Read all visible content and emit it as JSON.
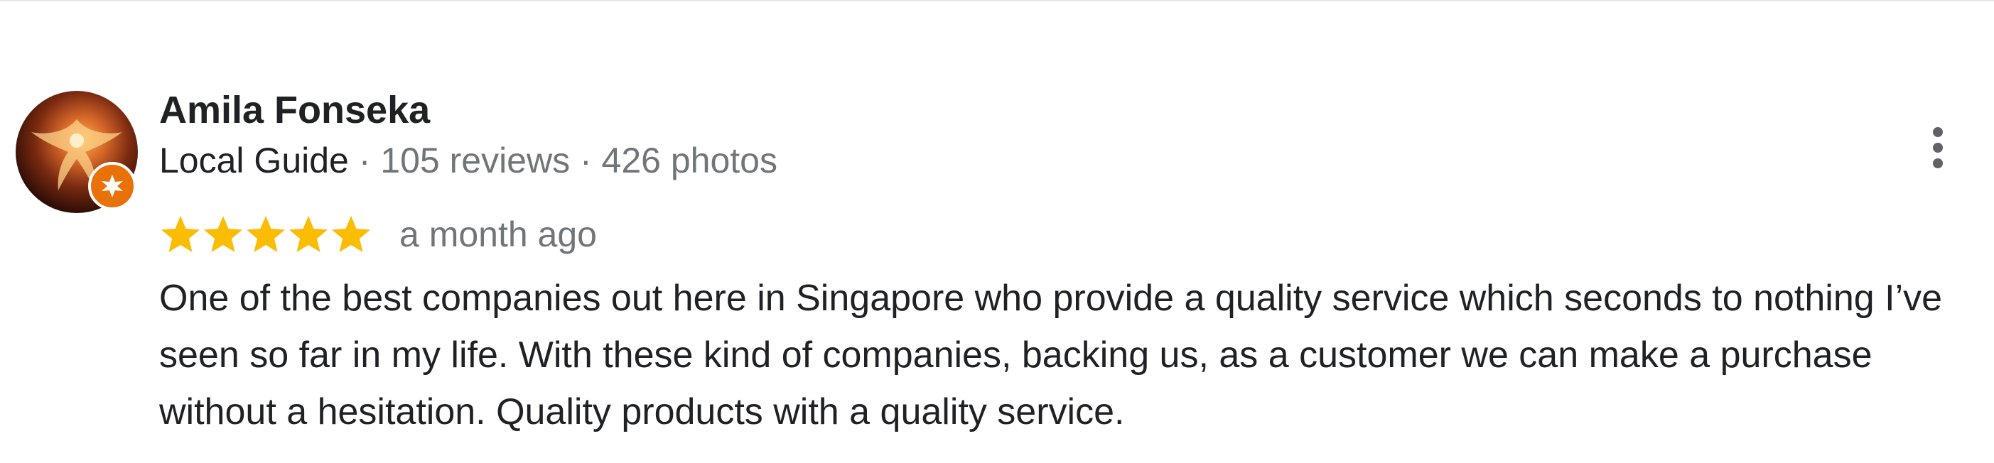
{
  "reviewer": {
    "name": "Amila Fonseka",
    "guide_label": "Local Guide",
    "separator": " · ",
    "reviews": "105 reviews",
    "photos": "426 photos",
    "avatar_icon": "phoenix-avatar",
    "badge_icon": "local-guide-star-badge"
  },
  "review": {
    "rating": 5,
    "max_rating": 5,
    "time_ago": "a month ago",
    "text": "One of the best companies out here in Singapore who provide a quality service which seconds to nothing I’ve seen so far in my life. With these kind of companies, backing us, as a customer we can make a purchase without a hesitation. Quality products with a quality service."
  },
  "actions": {
    "more_icon": "more-vertical-icon"
  },
  "colors": {
    "star": "#fbbc04",
    "badge": "#e8710a",
    "secondary_text": "#70757a",
    "primary_text": "#202124"
  }
}
